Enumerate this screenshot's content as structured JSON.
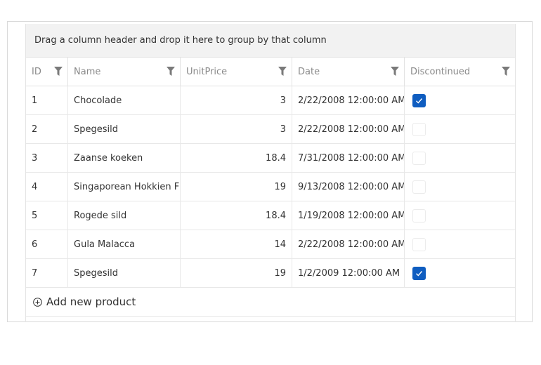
{
  "group_panel": {
    "text": "Drag a column header and drop it here to group by that column"
  },
  "columns": [
    {
      "label": "ID",
      "icon": "filter-icon"
    },
    {
      "label": "Name",
      "icon": "filter-icon"
    },
    {
      "label": "UnitPrice",
      "icon": "filter-icon"
    },
    {
      "label": "Date",
      "icon": "filter-icon"
    },
    {
      "label": "Discontinued",
      "icon": "filter-icon"
    }
  ],
  "rows": [
    {
      "id": "1",
      "name": "Chocolade",
      "price": "3",
      "date": "2/22/2008 12:00:00 AM",
      "discontinued": true
    },
    {
      "id": "2",
      "name": "Spegesild",
      "price": "3",
      "date": "2/22/2008 12:00:00 AM",
      "discontinued": false
    },
    {
      "id": "3",
      "name": "Zaanse koeken",
      "price": "18.4",
      "date": "7/31/2008 12:00:00 AM",
      "discontinued": false
    },
    {
      "id": "4",
      "name": "Singaporean Hokkien F",
      "price": "19",
      "date": "9/13/2008 12:00:00 AM",
      "discontinued": false
    },
    {
      "id": "5",
      "name": "Rogede sild",
      "price": "18.4",
      "date": "1/19/2008 12:00:00 AM",
      "discontinued": false
    },
    {
      "id": "6",
      "name": "Gula Malacca",
      "price": "14",
      "date": "2/22/2008 12:00:00 AM",
      "discontinued": false
    },
    {
      "id": "7",
      "name": "Spegesild",
      "price": "19",
      "date": "1/2/2009 12:00:00 AM",
      "discontinued": true
    }
  ],
  "add_row": {
    "label": "Add new product",
    "icon": "plus-circle-icon"
  },
  "colors": {
    "checkbox_checked": "#0f5dc0",
    "group_panel_bg": "#f2f2f2",
    "header_text": "#8a8a8a"
  }
}
